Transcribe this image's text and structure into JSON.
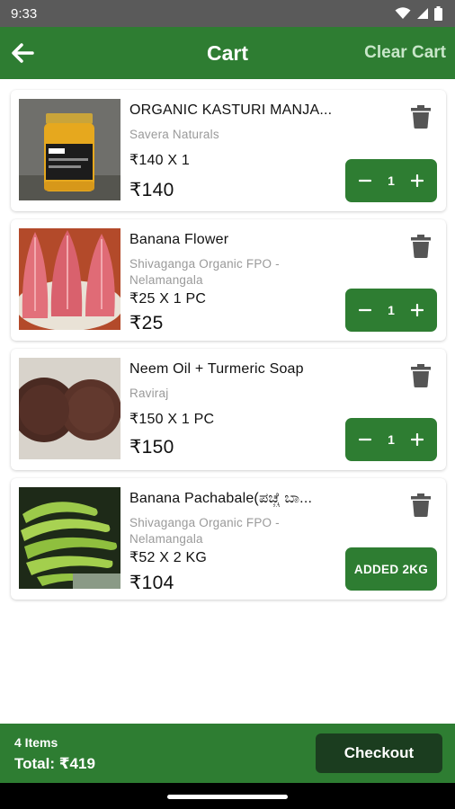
{
  "status_bar": {
    "time": "9:33"
  },
  "app_bar": {
    "title": "Cart",
    "clear_label": "Clear Cart"
  },
  "cart": {
    "items": [
      {
        "name": "ORGANIC KASTURI MANJA...",
        "seller": "Savera Naturals",
        "rate": "₹140 X 1",
        "total": "₹140",
        "quantity": "1",
        "action": "stepper",
        "image": "turmeric-jar"
      },
      {
        "name": "Banana Flower",
        "seller": "Shivaganga Organic FPO - Nelamangala",
        "rate": "₹25 X 1 PC",
        "total": "₹25",
        "quantity": "1",
        "action": "stepper",
        "image": "banana-flower"
      },
      {
        "name": "Neem Oil + Turmeric Soap",
        "seller": "Raviraj",
        "rate": "₹150 X 1 PC",
        "total": "₹150",
        "quantity": "1",
        "action": "stepper",
        "image": "soap"
      },
      {
        "name": "Banana Pachabale(ಪಚ್ಚೆ ಬಾ...",
        "seller": "Shivaganga Organic FPO - Nelamangala",
        "rate": "₹52 X 2 KG",
        "total": "₹104",
        "added_label": "ADDED 2KG",
        "action": "added",
        "image": "green-bananas"
      }
    ]
  },
  "footer": {
    "items_count": "4 Items",
    "total": "Total: ₹419",
    "checkout_label": "Checkout"
  },
  "colors": {
    "primary": "#2e7d32",
    "checkout": "#1b3d1f",
    "clear": "#c8e6c9"
  }
}
